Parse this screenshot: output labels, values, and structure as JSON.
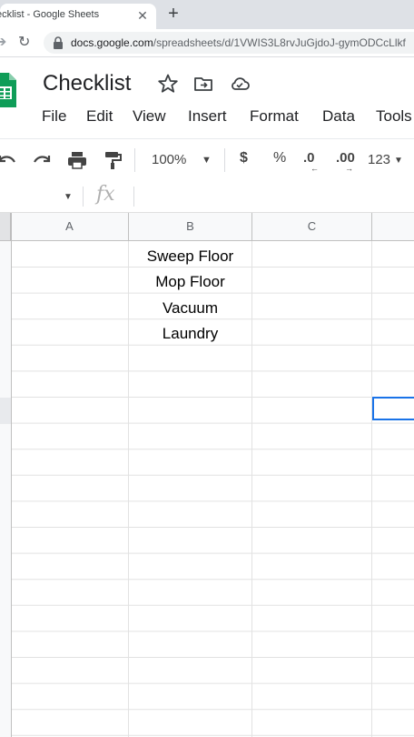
{
  "browser": {
    "tab_title": "ecklist - Google Sheets",
    "close_glyph": "✕",
    "new_tab_glyph": "+",
    "url_host": "docs.google.com",
    "url_path": "/spreadsheets/d/1VWIS3L8rvJuGjdoJ-gymODCcLlkf"
  },
  "sheet": {
    "title": "Checklist",
    "menus": [
      "File",
      "Edit",
      "View",
      "Insert",
      "Format",
      "Data",
      "Tools"
    ],
    "zoom": "100%",
    "currency": "$",
    "percent": "%",
    "decrease_decimals": ".0",
    "increase_decimals": ".00",
    "more_formats": "123",
    "fx_label": "fx"
  },
  "grid": {
    "columns": [
      "A",
      "B",
      "C"
    ],
    "column_b_values": [
      "Sweep Floor",
      "Mop Floor",
      "Vacuum",
      "Laundry"
    ]
  },
  "colors": {
    "accent": "#1a73e8",
    "sheets_green": "#0f9d58"
  }
}
